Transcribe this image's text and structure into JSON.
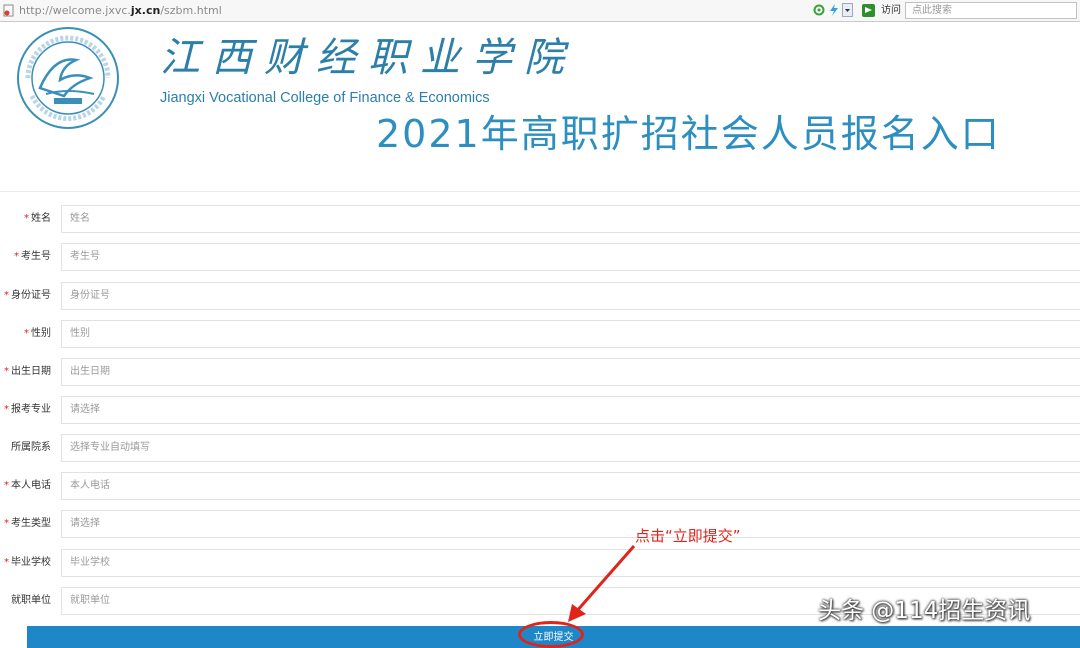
{
  "browser": {
    "url_prefix": "http://welcome.jxvc.",
    "url_domain": "jx.cn",
    "url_suffix": "/szbm.html",
    "visit_label": "访问",
    "search_placeholder": "点此搜索"
  },
  "header": {
    "college_cn": "江西财经职业学院",
    "college_en": "Jiangxi Vocational College of Finance & Economics",
    "headline": "2021年高职扩招社会人员报名入口"
  },
  "form": {
    "fields": [
      {
        "label": "姓名",
        "required": true,
        "placeholder": "姓名"
      },
      {
        "label": "考生号",
        "required": true,
        "placeholder": "考生号"
      },
      {
        "label": "身份证号",
        "required": true,
        "placeholder": "身份证号"
      },
      {
        "label": "性别",
        "required": true,
        "placeholder": "性别"
      },
      {
        "label": "出生日期",
        "required": true,
        "placeholder": "出生日期"
      },
      {
        "label": "报考专业",
        "required": true,
        "placeholder": "请选择"
      },
      {
        "label": "所属院系",
        "required": false,
        "placeholder": "选择专业自动填写"
      },
      {
        "label": "本人电话",
        "required": true,
        "placeholder": "本人电话"
      },
      {
        "label": "考生类型",
        "required": true,
        "placeholder": "请选择"
      },
      {
        "label": "毕业学校",
        "required": true,
        "placeholder": "毕业学校"
      },
      {
        "label": "就职单位",
        "required": false,
        "placeholder": "就职单位"
      }
    ],
    "required_mark": "*",
    "submit_label": "立即提交"
  },
  "annotation": {
    "text": "点击“立即提交”",
    "color": "#e2231a"
  },
  "watermark": "头条 @114招生资讯",
  "colors": {
    "accent": "#1e87c8",
    "brand": "#2c7fa8",
    "required": "#e02020"
  }
}
